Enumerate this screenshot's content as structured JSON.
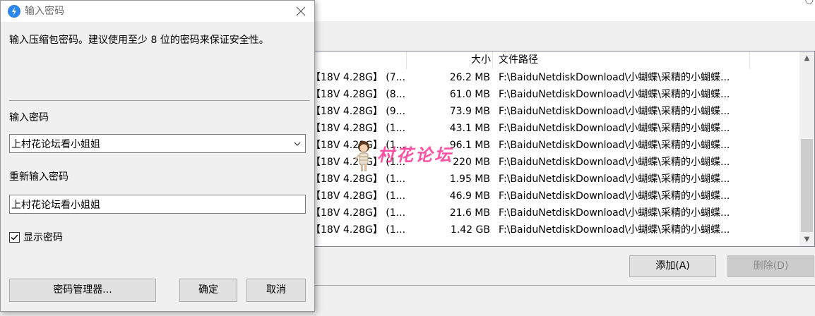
{
  "background_window": {
    "columns": {
      "size": "大小",
      "path": "文件路径"
    },
    "rows": [
      {
        "name": "【18V 4.28G】 (7...",
        "size": "26.2 MB",
        "path": "F:\\BaiduNetdiskDownload\\小蝴蝶\\采精的小蝴蝶..."
      },
      {
        "name": "【18V 4.28G】 (8...",
        "size": "61.0 MB",
        "path": "F:\\BaiduNetdiskDownload\\小蝴蝶\\采精的小蝴蝶..."
      },
      {
        "name": "【18V 4.28G】 (9...",
        "size": "73.9 MB",
        "path": "F:\\BaiduNetdiskDownload\\小蝴蝶\\采精的小蝴蝶..."
      },
      {
        "name": "【18V 4.28G】 (1...",
        "size": "43.1 MB",
        "path": "F:\\BaiduNetdiskDownload\\小蝴蝶\\采精的小蝴蝶..."
      },
      {
        "name": "【18V 4.28G】 (1...",
        "size": "96.1 MB",
        "path": "F:\\BaiduNetdiskDownload\\小蝴蝶\\采精的小蝴蝶..."
      },
      {
        "name": "【18V 4.28G】 (1...",
        "size": "220 MB",
        "path": "F:\\BaiduNetdiskDownload\\小蝴蝶\\采精的小蝴蝶..."
      },
      {
        "name": "【18V 4.28G】 (1...",
        "size": "1.95 MB",
        "path": "F:\\BaiduNetdiskDownload\\小蝴蝶\\采精的小蝴蝶..."
      },
      {
        "name": "【18V 4.28G】 (1...",
        "size": "46.9 MB",
        "path": "F:\\BaiduNetdiskDownload\\小蝴蝶\\采精的小蝴蝶..."
      },
      {
        "name": "【18V 4.28G】 (1...",
        "size": "21.6 MB",
        "path": "F:\\BaiduNetdiskDownload\\小蝴蝶\\采精的小蝴蝶..."
      },
      {
        "name": "【18V 4.28G】 (1...",
        "size": "1.42 GB",
        "path": "F:\\BaiduNetdiskDownload\\小蝴蝶\\采精的小蝴蝶..."
      }
    ],
    "add_button": "添加(A)",
    "remove_button": "删除(D)",
    "watermark_text": "村花论坛"
  },
  "dialog": {
    "title": "输入密码",
    "app_icon": "thunder-icon",
    "close_icon": "close-icon",
    "description": "输入压缩包密码。建议使用至少 8 位的密码来保证安全性。",
    "password_label": "输入密码",
    "password_value": "上村花论坛看小姐姐",
    "repeat_label": "重新输入密码",
    "repeat_value": "上村花论坛看小姐姐",
    "show_password_label": "显示密码",
    "show_password_checked": true,
    "buttons": {
      "manager": "密码管理器...",
      "ok": "确定",
      "cancel": "取消"
    }
  }
}
